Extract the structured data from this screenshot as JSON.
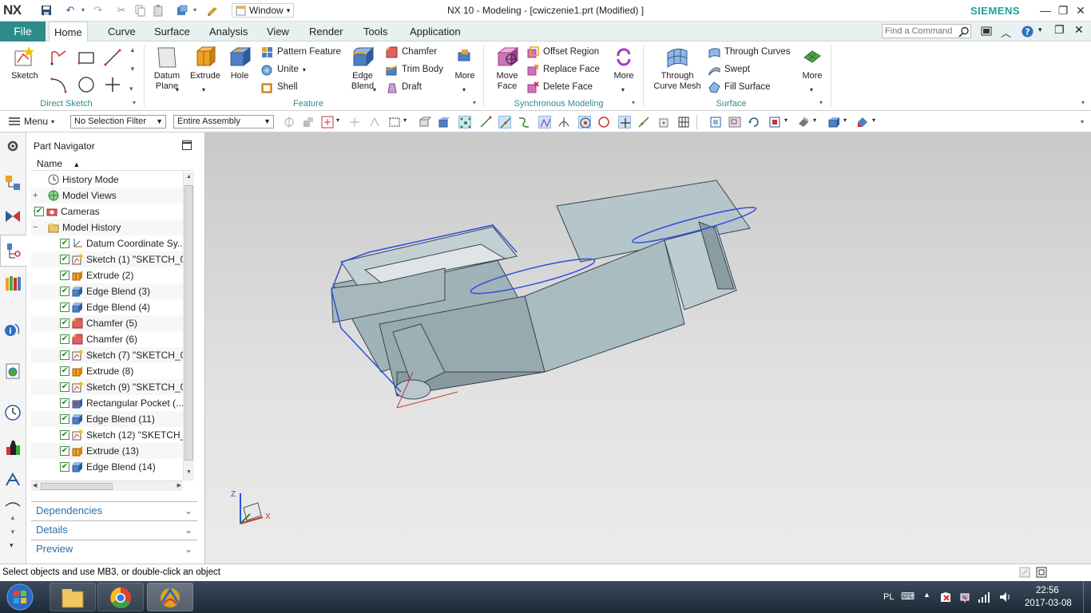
{
  "app": {
    "logo": "NX",
    "title": "NX 10 - Modeling - [cwiczenie1.prt (Modified) ]",
    "brand": "SIEMENS",
    "window_menu": "Window"
  },
  "tabs": {
    "file": "File",
    "items": [
      "Home",
      "Curve",
      "Surface",
      "Analysis",
      "View",
      "Render",
      "Tools",
      "Application"
    ],
    "active": "Home",
    "find_placeholder": "Find a Command"
  },
  "ribbon": {
    "direct_sketch": {
      "label": "Direct Sketch",
      "sketch": "Sketch"
    },
    "feature": {
      "label": "Feature",
      "datum_plane": [
        "Datum",
        "Plane"
      ],
      "extrude": "Extrude",
      "hole": "Hole",
      "pattern_feature": "Pattern Feature",
      "unite": "Unite",
      "shell": "Shell",
      "edge_blend": [
        "Edge",
        "Blend"
      ],
      "chamfer": "Chamfer",
      "trim_body": "Trim Body",
      "draft": "Draft",
      "more": "More"
    },
    "sync": {
      "label": "Synchronous Modeling",
      "move_face": [
        "Move",
        "Face"
      ],
      "offset_region": "Offset Region",
      "replace_face": "Replace Face",
      "delete_face": "Delete Face",
      "more": "More"
    },
    "surface": {
      "label": "Surface",
      "through_curve_mesh": [
        "Through",
        "Curve Mesh"
      ],
      "through_curves": "Through Curves",
      "swept": "Swept",
      "fill_surface": "Fill Surface",
      "more": "More"
    }
  },
  "toolbar2": {
    "menu": "Menu",
    "selection_filter": "No Selection Filter",
    "assembly_scope": "Entire Assembly"
  },
  "navigator": {
    "title": "Part Navigator",
    "column": "Name",
    "rows": [
      {
        "label": "History Mode",
        "check": false,
        "expander": "",
        "indent": 1,
        "icon": "clock-icon"
      },
      {
        "label": "Model Views",
        "check": false,
        "expander": "+",
        "indent": 1,
        "icon": "views-icon"
      },
      {
        "label": "Cameras",
        "check": true,
        "expander": "+",
        "indent": 1,
        "icon": "camera-icon"
      },
      {
        "label": "Model History",
        "check": false,
        "expander": "-",
        "indent": 1,
        "icon": "folder-icon"
      },
      {
        "label": "Datum Coordinate Sy...",
        "check": true,
        "expander": "",
        "indent": 2,
        "icon": "datum-csys-icon"
      },
      {
        "label": "Sketch (1) \"SKETCH_0",
        "check": true,
        "expander": "",
        "indent": 2,
        "icon": "sketch-icon"
      },
      {
        "label": "Extrude (2)",
        "check": true,
        "expander": "",
        "indent": 2,
        "icon": "extrude-icon"
      },
      {
        "label": "Edge Blend (3)",
        "check": true,
        "expander": "",
        "indent": 2,
        "icon": "edge-blend-icon"
      },
      {
        "label": "Edge Blend (4)",
        "check": true,
        "expander": "",
        "indent": 2,
        "icon": "edge-blend-icon"
      },
      {
        "label": "Chamfer (5)",
        "check": true,
        "expander": "",
        "indent": 2,
        "icon": "chamfer-icon"
      },
      {
        "label": "Chamfer (6)",
        "check": true,
        "expander": "",
        "indent": 2,
        "icon": "chamfer-icon"
      },
      {
        "label": "Sketch (7) \"SKETCH_0",
        "check": true,
        "expander": "",
        "indent": 2,
        "icon": "sketch-icon"
      },
      {
        "label": "Extrude (8)",
        "check": true,
        "expander": "",
        "indent": 2,
        "icon": "extrude-icon"
      },
      {
        "label": "Sketch (9) \"SKETCH_0",
        "check": true,
        "expander": "",
        "indent": 2,
        "icon": "sketch-icon"
      },
      {
        "label": "Rectangular Pocket (...",
        "check": true,
        "expander": "",
        "indent": 2,
        "icon": "pocket-icon"
      },
      {
        "label": "Edge Blend (11)",
        "check": true,
        "expander": "",
        "indent": 2,
        "icon": "edge-blend-icon"
      },
      {
        "label": "Sketch (12) \"SKETCH_",
        "check": true,
        "expander": "",
        "indent": 2,
        "icon": "sketch-icon"
      },
      {
        "label": "Extrude (13)",
        "check": true,
        "expander": "",
        "indent": 2,
        "icon": "extrude-icon"
      },
      {
        "label": "Edge Blend (14)",
        "check": true,
        "expander": "",
        "indent": 2,
        "icon": "edge-blend-icon"
      }
    ],
    "panels": [
      "Dependencies",
      "Details",
      "Preview"
    ]
  },
  "viewport": {
    "triad_x": "X",
    "triad_z": "Z",
    "body_color": "#a9bcc0",
    "edge_color": "#3a4450",
    "highlight_color": "#2b4fe0"
  },
  "status": {
    "message": "Select objects and use MB3, or double-click an object"
  },
  "taskbar": {
    "lang": "PL",
    "time": "22:56",
    "date": "2017-03-08"
  }
}
